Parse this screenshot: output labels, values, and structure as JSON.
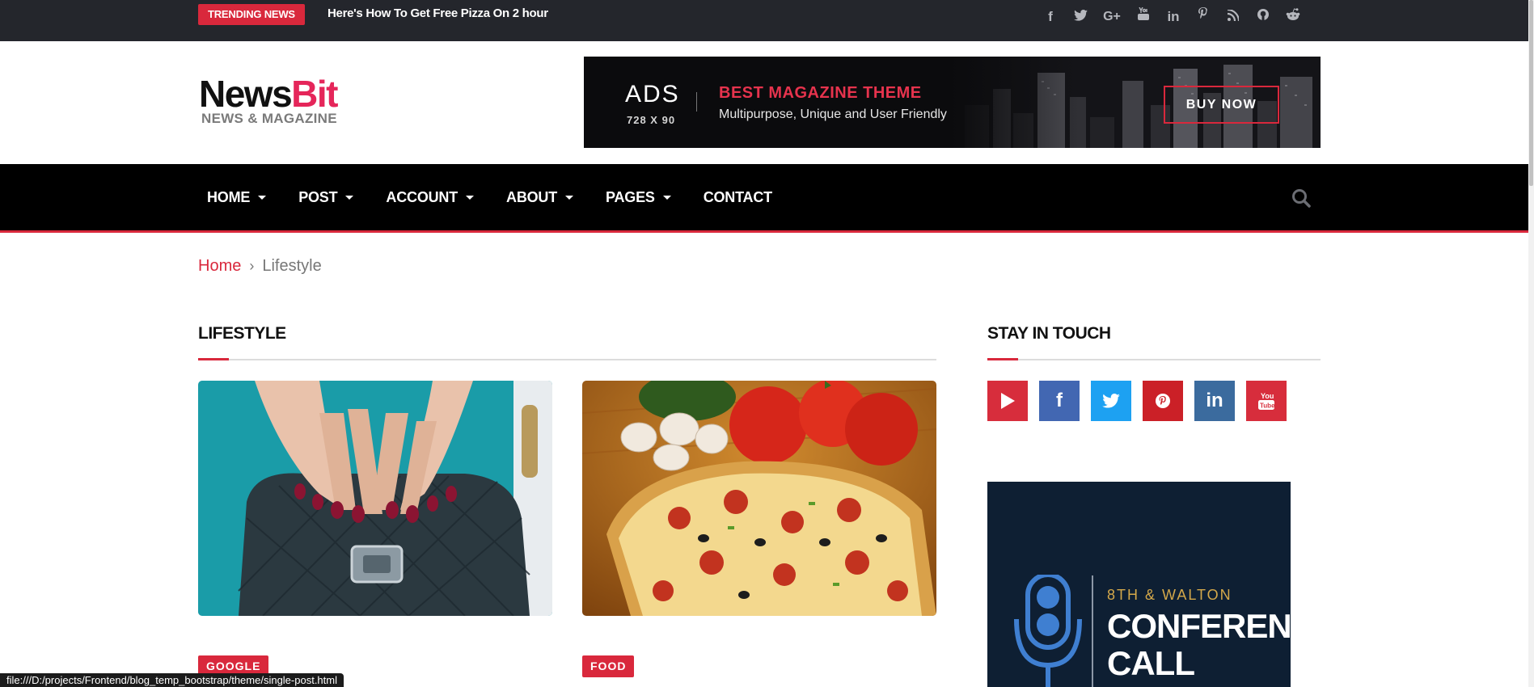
{
  "topbar": {
    "trending_label": "TRENDING NEWS",
    "trending_headline": "Here's How To Get Free Pizza On 2 hour",
    "social_icons": [
      "facebook-icon",
      "twitter-icon",
      "google-plus-icon",
      "youtube-icon",
      "linkedin-icon",
      "pinterest-icon",
      "rss-icon",
      "github-icon",
      "reddit-icon"
    ]
  },
  "header": {
    "logo_part1": "News",
    "logo_part2": "Bit",
    "logo_tagline": "NEWS & MAGAZINE",
    "ad": {
      "label": "ADS",
      "size": "728 X 90",
      "title": "BEST MAGAZINE THEME",
      "description": "Multipurpose, Unique and User Friendly",
      "button": "BUY NOW"
    }
  },
  "nav": {
    "items": [
      {
        "label": "HOME",
        "dropdown": true
      },
      {
        "label": "POST",
        "dropdown": true
      },
      {
        "label": "ACCOUNT",
        "dropdown": true
      },
      {
        "label": "ABOUT",
        "dropdown": true
      },
      {
        "label": "PAGES",
        "dropdown": true
      },
      {
        "label": "CONTACT",
        "dropdown": false
      }
    ],
    "search_icon": "search-icon"
  },
  "breadcrumb": {
    "home": "Home",
    "separator": "›",
    "current": "Lifestyle"
  },
  "main": {
    "section_title": "LIFESTYLE",
    "cards": [
      {
        "tag": "GOOGLE",
        "image": "handbag-photo"
      },
      {
        "tag": "FOOD",
        "image": "pizza-photo"
      }
    ]
  },
  "sidebar": {
    "section_title": "STAY IN TOUCH",
    "social": [
      {
        "icon": "play-icon",
        "color": "#d72d3c"
      },
      {
        "icon": "facebook-icon",
        "color": "#4267b2"
      },
      {
        "icon": "twitter-icon",
        "color": "#1da1f2"
      },
      {
        "icon": "pinterest-icon",
        "color": "#cb2027"
      },
      {
        "icon": "linkedin-icon",
        "color": "#3b6b9e"
      },
      {
        "icon": "youtube-icon",
        "color": "#d72d3c"
      }
    ],
    "podcast_ad": {
      "subtitle": "8TH & WALTON",
      "title_line1": "CONFERENCE",
      "title_line2": "CALL"
    }
  },
  "statusbar": {
    "url": "file:///D:/projects/Frontend/blog_temp_bootstrap/theme/single-post.html"
  },
  "colors": {
    "accent": "#d9283c",
    "topbar_bg": "#24262c",
    "nav_bg": "#000000"
  }
}
